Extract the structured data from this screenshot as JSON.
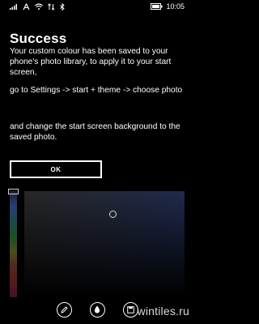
{
  "status_bar": {
    "time": "10:05"
  },
  "dialog": {
    "title": "Success",
    "paragraphs": [
      "Your custom colour has been saved to your phone's photo library, to apply it to your start screen,",
      "go to Settings -> start + theme -> choose photo",
      "and change the start screen background to the saved photo."
    ],
    "ok_label": "OK"
  },
  "app_bar": {
    "buttons": [
      "pencil-icon",
      "drop-icon",
      "save-icon"
    ]
  },
  "watermark": "wintiles.ru",
  "colors": {
    "accent": "#1f2a4d",
    "background": "#000000",
    "text": "#ffffff"
  }
}
